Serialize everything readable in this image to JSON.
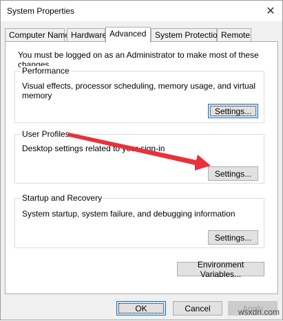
{
  "window": {
    "title": "System Properties"
  },
  "tabs": [
    {
      "label": "Computer Name"
    },
    {
      "label": "Hardware"
    },
    {
      "label": "Advanced"
    },
    {
      "label": "System Protection"
    },
    {
      "label": "Remote"
    }
  ],
  "admin_note": "You must be logged on as an Administrator to make most of these changes.",
  "performance": {
    "title": "Performance",
    "description": "Visual effects, processor scheduling, memory usage, and virtual memory",
    "button": "Settings..."
  },
  "user_profiles": {
    "title": "User Profiles",
    "description": "Desktop settings related to your sign-in",
    "button": "Settings..."
  },
  "startup_recovery": {
    "title": "Startup and Recovery",
    "description": "System startup, system failure, and debugging information",
    "button": "Settings..."
  },
  "env_button": "Environment Variables...",
  "footer": {
    "ok": "OK",
    "cancel": "Cancel",
    "apply": "Apply"
  },
  "watermark": "wsxdn.com",
  "colors": {
    "annotation_arrow": "#e8313a",
    "focus_border": "#0078d7"
  }
}
